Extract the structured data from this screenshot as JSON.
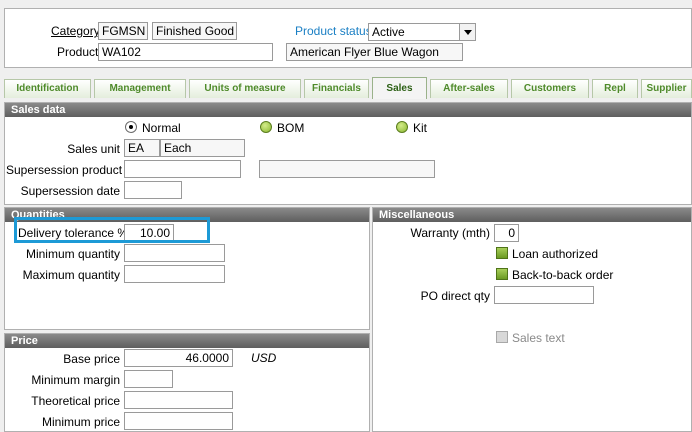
{
  "header": {
    "category_label": "Category",
    "category_code": "FGMSN",
    "category_name": "Finished Good",
    "product_status_label": "Product status",
    "product_status_value": "Active",
    "product_label": "Product",
    "product_code": "WA102",
    "product_name": "American Flyer Blue Wagon"
  },
  "tabs": [
    {
      "label": "Identification"
    },
    {
      "label": "Management"
    },
    {
      "label": "Units of measure"
    },
    {
      "label": "Financials"
    },
    {
      "label": "Sales"
    },
    {
      "label": "After-sales"
    },
    {
      "label": "Customers"
    },
    {
      "label": "Repl"
    },
    {
      "label": "Supplier"
    }
  ],
  "active_tab": "Sales",
  "sales_data": {
    "title": "Sales data",
    "type_options": [
      {
        "label": "Normal",
        "selected": true
      },
      {
        "label": "BOM",
        "selected": false
      },
      {
        "label": "Kit",
        "selected": false
      }
    ],
    "sales_unit_label": "Sales unit",
    "sales_unit_code": "EA",
    "sales_unit_name": "Each",
    "supersession_product_label": "Supersession product",
    "supersession_product_value": "",
    "supersession_product_name": "",
    "supersession_date_label": "Supersession date",
    "supersession_date_value": ""
  },
  "quantities": {
    "title": "Quantities",
    "delivery_tolerance_label": "Delivery tolerance %",
    "delivery_tolerance_value": "10.00",
    "minimum_quantity_label": "Minimum quantity",
    "minimum_quantity_value": "",
    "maximum_quantity_label": "Maximum quantity",
    "maximum_quantity_value": ""
  },
  "miscellaneous": {
    "title": "Miscellaneous",
    "warranty_label": "Warranty (mth)",
    "warranty_value": "0",
    "loan_authorized_label": "Loan authorized",
    "back_to_back_label": "Back-to-back order",
    "po_direct_qty_label": "PO direct qty",
    "po_direct_qty_value": "",
    "sales_text_label": "Sales text"
  },
  "price": {
    "title": "Price",
    "base_price_label": "Base price",
    "base_price_value": "46.0000",
    "currency": "USD",
    "minimum_margin_label": "Minimum margin",
    "minimum_margin_value": "",
    "theoretical_price_label": "Theoretical price",
    "theoretical_price_value": "",
    "minimum_price_label": "Minimum price",
    "minimum_price_value": ""
  },
  "colors": {
    "highlight": "#1d9ad6",
    "tab_text": "#4e8a2a",
    "link_blue": "#1a7fc4",
    "section_header": "#6e6e6e"
  }
}
